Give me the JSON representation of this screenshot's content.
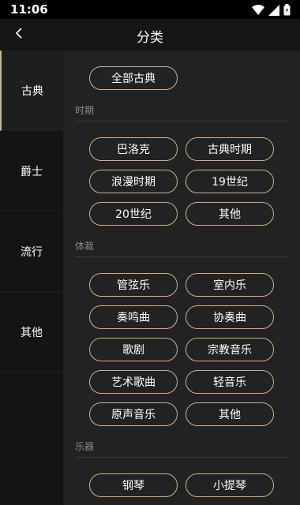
{
  "status": {
    "time": "11:06"
  },
  "header": {
    "title": "分类"
  },
  "sidebar": {
    "items": [
      {
        "label": "古典"
      },
      {
        "label": "爵士"
      },
      {
        "label": "流行"
      },
      {
        "label": "其他"
      }
    ]
  },
  "content": {
    "all_button": "全部古典",
    "sections": [
      {
        "title": "时期",
        "tags": [
          "巴洛克",
          "古典时期",
          "浪漫时期",
          "19世纪",
          "20世纪",
          "其他"
        ]
      },
      {
        "title": "体裁",
        "tags": [
          "管弦乐",
          "室内乐",
          "奏鸣曲",
          "协奏曲",
          "歌剧",
          "宗教音乐",
          "艺术歌曲",
          "轻音乐",
          "原声音乐",
          "其他"
        ]
      },
      {
        "title": "乐器",
        "tags": [
          "钢琴",
          "小提琴"
        ]
      }
    ]
  },
  "colors": {
    "accent": "#c9b48c",
    "background": "#222222",
    "sidebar": "#141414"
  },
  "icons": {
    "back": "chevron-left-icon",
    "wifi": "wifi-icon",
    "signal": "signal-icon",
    "battery": "battery-icon"
  }
}
